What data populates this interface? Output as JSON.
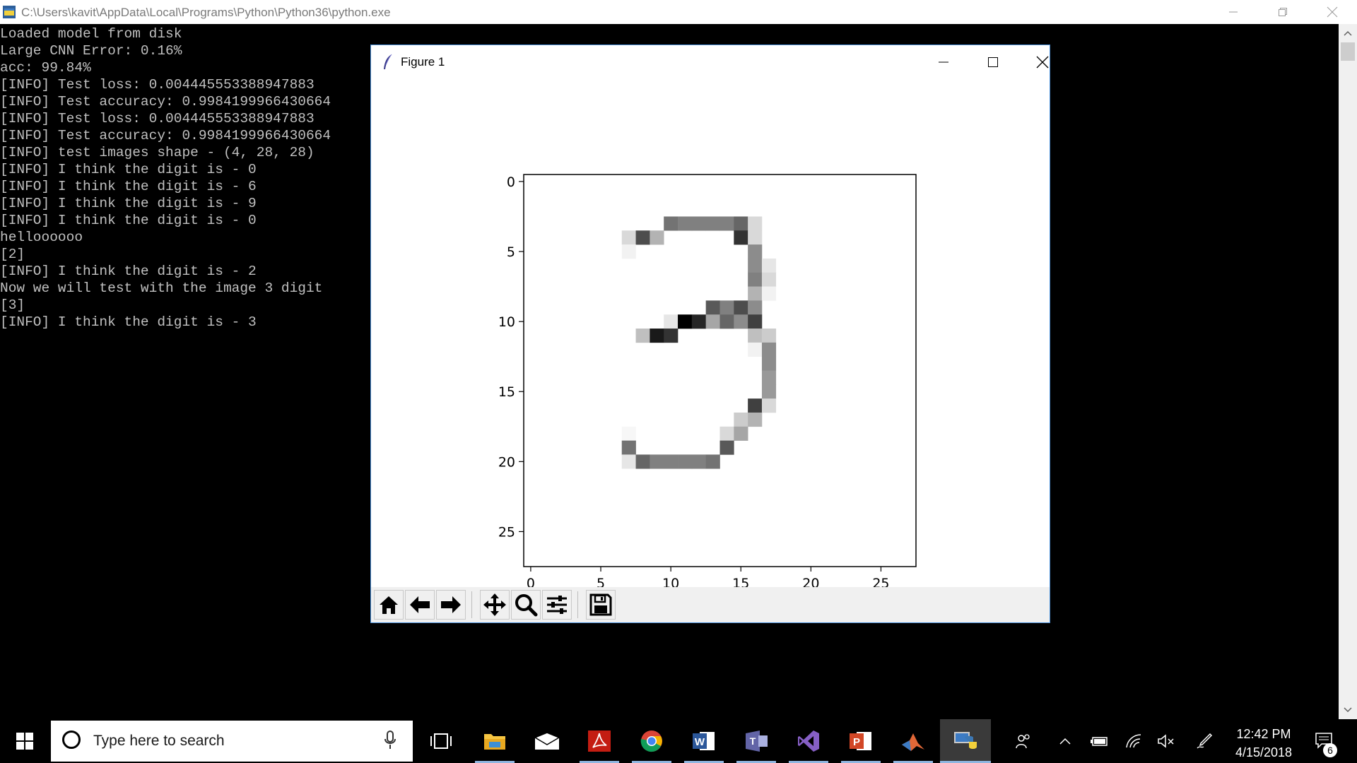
{
  "console": {
    "title": "C:\\Users\\kavit\\AppData\\Local\\Programs\\Python\\Python36\\python.exe",
    "lines": [
      "Loaded model from disk",
      "Large CNN Error: 0.16%",
      "acc: 99.84%",
      "[INFO] Test loss: 0.004445553388947883",
      "[INFO] Test accuracy: 0.9984199966430664",
      "[INFO] Test loss: 0.004445553388947883",
      "[INFO] Test accuracy: 0.9984199966430664",
      "[INFO] test images shape - (4, 28, 28)",
      "[INFO] I think the digit is - 0",
      "[INFO] I think the digit is - 6",
      "[INFO] I think the digit is - 9",
      "[INFO] I think the digit is - 0",
      "helloooooo",
      "[2]",
      "[INFO] I think the digit is - 2",
      "Now we will test with the image 3 digit",
      "[3]",
      "[INFO] I think the digit is - 3"
    ]
  },
  "figure": {
    "title": "Figure 1",
    "toolbar": [
      "home-icon",
      "back-icon",
      "forward-icon",
      "pan-icon",
      "zoom-icon",
      "configure-subplots-icon",
      "save-icon"
    ]
  },
  "chart_data": {
    "type": "heatmap",
    "colormap": "gray_r",
    "rows": 28,
    "cols": 28,
    "xticks": [
      0,
      5,
      10,
      15,
      20,
      25
    ],
    "yticks": [
      0,
      5,
      10,
      15,
      20,
      25
    ],
    "cells": [
      [
        3,
        10,
        0.55
      ],
      [
        3,
        11,
        0.5
      ],
      [
        3,
        12,
        0.5
      ],
      [
        3,
        13,
        0.5
      ],
      [
        3,
        14,
        0.5
      ],
      [
        3,
        15,
        0.6
      ],
      [
        3,
        16,
        0.15
      ],
      [
        4,
        7,
        0.15
      ],
      [
        4,
        8,
        0.7
      ],
      [
        4,
        9,
        0.3
      ],
      [
        4,
        15,
        0.8
      ],
      [
        4,
        16,
        0.15
      ],
      [
        5,
        7,
        0.05
      ],
      [
        5,
        16,
        0.45
      ],
      [
        6,
        16,
        0.45
      ],
      [
        6,
        17,
        0.1
      ],
      [
        7,
        16,
        0.5
      ],
      [
        7,
        17,
        0.15
      ],
      [
        8,
        16,
        0.3
      ],
      [
        8,
        17,
        0.05
      ],
      [
        9,
        13,
        0.65
      ],
      [
        9,
        14,
        0.5
      ],
      [
        9,
        15,
        0.7
      ],
      [
        9,
        16,
        0.45
      ],
      [
        10,
        10,
        0.1
      ],
      [
        10,
        11,
        1.0
      ],
      [
        10,
        12,
        0.85
      ],
      [
        10,
        13,
        0.35
      ],
      [
        10,
        14,
        0.6
      ],
      [
        10,
        15,
        0.45
      ],
      [
        10,
        16,
        0.75
      ],
      [
        11,
        8,
        0.25
      ],
      [
        11,
        9,
        0.9
      ],
      [
        11,
        10,
        0.8
      ],
      [
        11,
        16,
        0.25
      ],
      [
        11,
        17,
        0.2
      ],
      [
        12,
        16,
        0.05
      ],
      [
        12,
        17,
        0.45
      ],
      [
        13,
        17,
        0.45
      ],
      [
        14,
        17,
        0.4
      ],
      [
        15,
        17,
        0.4
      ],
      [
        16,
        16,
        0.75
      ],
      [
        16,
        17,
        0.15
      ],
      [
        17,
        15,
        0.2
      ],
      [
        17,
        16,
        0.3
      ],
      [
        18,
        7,
        0.03
      ],
      [
        18,
        14,
        0.15
      ],
      [
        18,
        15,
        0.35
      ],
      [
        19,
        7,
        0.55
      ],
      [
        19,
        14,
        0.65
      ],
      [
        20,
        7,
        0.1
      ],
      [
        20,
        8,
        0.6
      ],
      [
        20,
        9,
        0.5
      ],
      [
        20,
        10,
        0.5
      ],
      [
        20,
        11,
        0.5
      ],
      [
        20,
        12,
        0.5
      ],
      [
        20,
        13,
        0.55
      ]
    ]
  },
  "taskbar": {
    "search_placeholder": "Type here to search",
    "apps": [
      "task-view-icon",
      "file-explorer-icon",
      "mail-icon",
      "acrobat-icon",
      "chrome-icon",
      "word-icon",
      "teams-icon",
      "visual-studio-icon",
      "powerpoint-icon",
      "matlab-icon",
      "python-icon"
    ],
    "time": "12:42 PM",
    "date": "4/15/2018",
    "notification_count": "6"
  },
  "colors": {
    "console_bg": "#000000",
    "console_text": "#c0c0c0",
    "accent_blue": "#4a90d9"
  }
}
